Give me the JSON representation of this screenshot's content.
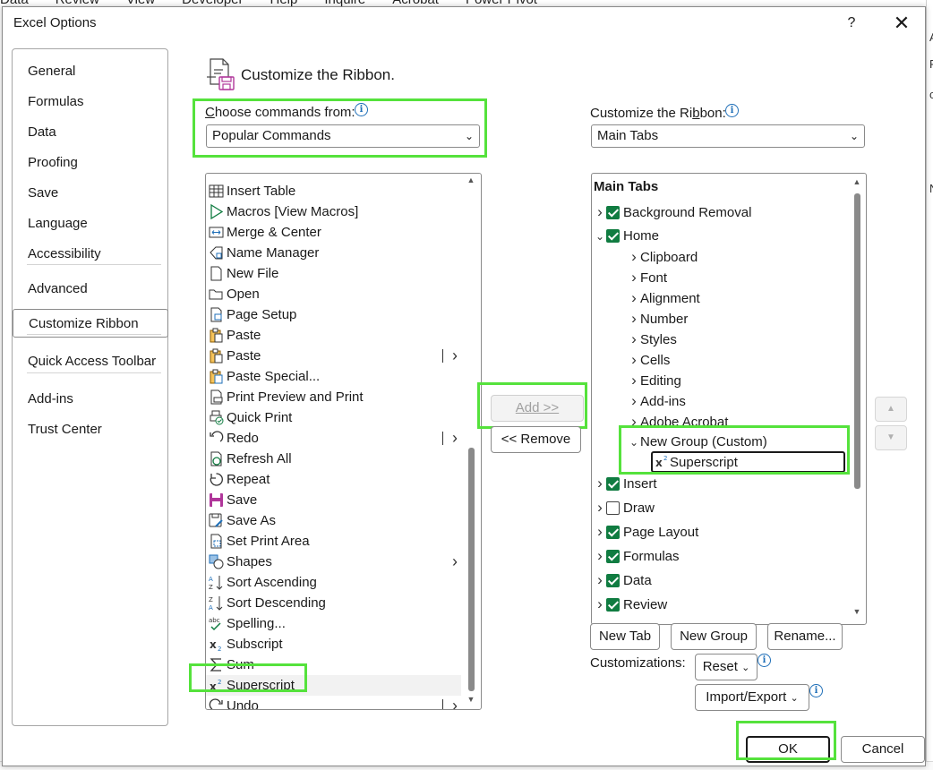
{
  "background": {
    "menu": [
      "Data",
      "Review",
      "View",
      "Developer",
      "Help",
      "Inquire",
      "Acrobat",
      "Power Pivot"
    ],
    "right_letters": [
      "A",
      "F",
      "c",
      "N"
    ]
  },
  "dialog": {
    "title": "Excel Options",
    "help_glyph": "?",
    "close_glyph": "✕"
  },
  "nav": {
    "items": [
      "General",
      "Formulas",
      "Data",
      "Proofing",
      "Save",
      "Language",
      "Accessibility",
      "Advanced",
      "Customize Ribbon",
      "Quick Access Toolbar",
      "Add-ins",
      "Trust Center"
    ],
    "selected": "Customize Ribbon"
  },
  "heading": "Customize the Ribbon.",
  "left": {
    "label_prefix": "C",
    "label_rest": "hoose commands from:",
    "select_value": "Popular Commands",
    "commands": [
      {
        "label": "Insert Table",
        "icon": "table-icon"
      },
      {
        "label": "Macros [View Macros]",
        "icon": "play-icon"
      },
      {
        "label": "Merge & Center",
        "icon": "merge-icon"
      },
      {
        "label": "Name Manager",
        "icon": "name-manager-icon"
      },
      {
        "label": "New File",
        "icon": "new-file-icon"
      },
      {
        "label": "Open",
        "icon": "folder-icon"
      },
      {
        "label": "Page Setup",
        "icon": "page-setup-icon"
      },
      {
        "label": "Paste",
        "icon": "paste-icon"
      },
      {
        "label": "Paste",
        "icon": "paste-icon"
      },
      {
        "label": "Paste Special...",
        "icon": "paste-special-icon"
      },
      {
        "label": "Print Preview and Print",
        "icon": "print-preview-icon"
      },
      {
        "label": "Quick Print",
        "icon": "quick-print-icon"
      },
      {
        "label": "Redo",
        "icon": "redo-icon"
      },
      {
        "label": "Refresh All",
        "icon": "refresh-icon"
      },
      {
        "label": "Repeat",
        "icon": "repeat-icon"
      },
      {
        "label": "Save",
        "icon": "save-icon"
      },
      {
        "label": "Save As",
        "icon": "save-as-icon"
      },
      {
        "label": "Set Print Area",
        "icon": "print-area-icon"
      },
      {
        "label": "Shapes",
        "icon": "shapes-icon"
      },
      {
        "label": "Sort Ascending",
        "icon": "sort-ascending-icon"
      },
      {
        "label": "Sort Descending",
        "icon": "sort-descending-icon"
      },
      {
        "label": "Spelling...",
        "icon": "spelling-icon"
      },
      {
        "label": "Subscript",
        "icon": "subscript-icon"
      },
      {
        "label": "Sum",
        "icon": "sum-icon"
      },
      {
        "label": "Superscript",
        "icon": "superscript-icon"
      },
      {
        "label": "Undo",
        "icon": "undo-icon"
      }
    ],
    "selected": "Superscript"
  },
  "middle": {
    "add_label": "Add >>",
    "remove_label": "<< Remove"
  },
  "right": {
    "label_prefix": "Customize the Ri",
    "label_underline": "b",
    "label_rest": "bon:",
    "select_value": "Main Tabs",
    "tree_header": "Main Tabs",
    "tree": [
      {
        "label": "Background Removal",
        "level": 0,
        "expanded": false,
        "check": "on"
      },
      {
        "label": "Home",
        "level": 0,
        "expanded": true,
        "check": "on"
      },
      {
        "label": "Clipboard",
        "level": 1,
        "expanded": false
      },
      {
        "label": "Font",
        "level": 1,
        "expanded": false
      },
      {
        "label": "Alignment",
        "level": 1,
        "expanded": false
      },
      {
        "label": "Number",
        "level": 1,
        "expanded": false
      },
      {
        "label": "Styles",
        "level": 1,
        "expanded": false
      },
      {
        "label": "Cells",
        "level": 1,
        "expanded": false
      },
      {
        "label": "Editing",
        "level": 1,
        "expanded": false
      },
      {
        "label": "Add-ins",
        "level": 1,
        "expanded": false
      },
      {
        "label": "Adobe Acrobat",
        "level": 1,
        "expanded": false
      },
      {
        "label": "New Group (Custom)",
        "level": 1,
        "expanded": true
      },
      {
        "label": "Superscript",
        "level": 2,
        "icon": "superscript-icon"
      },
      {
        "label": "Insert",
        "level": 0,
        "expanded": false,
        "check": "on"
      },
      {
        "label": "Draw",
        "level": 0,
        "expanded": false,
        "check": "off"
      },
      {
        "label": "Page Layout",
        "level": 0,
        "expanded": false,
        "check": "on"
      },
      {
        "label": "Formulas",
        "level": 0,
        "expanded": false,
        "check": "on"
      },
      {
        "label": "Data",
        "level": 0,
        "expanded": false,
        "check": "on"
      },
      {
        "label": "Review",
        "level": 0,
        "expanded": false,
        "check": "on"
      }
    ],
    "selected": "Superscript",
    "new_tab_label": "New Tab",
    "new_group_label": "New Group",
    "rename_label": "Rename...",
    "customizations_label": "Customizations:",
    "reset_label": "Reset",
    "import_export_label": "Import/Export"
  },
  "footer": {
    "ok_label": "OK",
    "cancel_label": "Cancel"
  },
  "colors": {
    "highlight": "#55e23c",
    "checkbox_on": "#107c41",
    "info": "#1f6fb8"
  }
}
